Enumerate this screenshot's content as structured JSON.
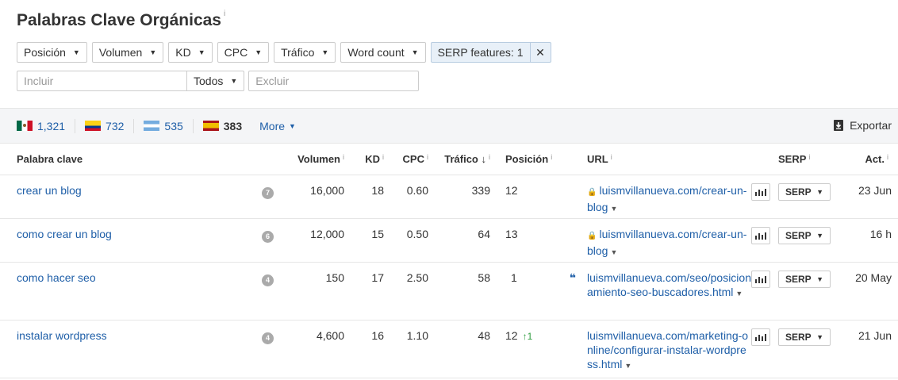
{
  "header": {
    "title": "Palabras Clave Orgánicas",
    "info": "i"
  },
  "filters": [
    {
      "label": "Posición",
      "caret": "▼"
    },
    {
      "label": "Volumen",
      "caret": "▼"
    },
    {
      "label": "KD",
      "caret": "▼"
    },
    {
      "label": "CPC",
      "caret": "▼"
    },
    {
      "label": "Tráfico",
      "caret": "▼"
    },
    {
      "label": "Word count",
      "caret": "▼"
    }
  ],
  "serp_filter": {
    "label": "SERP features: 1",
    "close": "✕"
  },
  "search": {
    "include_placeholder": "Incluir",
    "mode": "Todos",
    "exclude_placeholder": "Excluir"
  },
  "countries": [
    {
      "flag": "mx",
      "count": "1,321"
    },
    {
      "flag": "co",
      "count": "732"
    },
    {
      "flag": "ar",
      "count": "535"
    },
    {
      "flag": "es",
      "count": "383"
    }
  ],
  "more_label": "More",
  "export_label": "Exportar",
  "columns": {
    "keyword": "Palabra clave",
    "volume": "Volumen",
    "kd": "KD",
    "cpc": "CPC",
    "traffic": "Tráfico",
    "position": "Posición",
    "url": "URL",
    "serp": "SERP",
    "updated": "Act."
  },
  "rows": [
    {
      "keyword": "crear un blog",
      "word_count": "7",
      "volume": "16,000",
      "kd": "18",
      "cpc": "0.60",
      "traffic": "339",
      "position": "12",
      "position_change": "",
      "quote": "",
      "secure": true,
      "url": "luismvillanueva.com/crear-un-blog",
      "serp": "SERP",
      "updated": "23 Jun"
    },
    {
      "keyword": "como crear un blog",
      "word_count": "6",
      "volume": "12,000",
      "kd": "15",
      "cpc": "0.50",
      "traffic": "64",
      "position": "13",
      "position_change": "",
      "quote": "",
      "secure": true,
      "url": "luismvillanueva.com/crear-un-blog",
      "serp": "SERP",
      "updated": "16 h"
    },
    {
      "keyword": "como hacer seo",
      "word_count": "4",
      "volume": "150",
      "kd": "17",
      "cpc": "2.50",
      "traffic": "58",
      "position": "1",
      "position_change": "",
      "quote": "❝",
      "secure": false,
      "url": "luismvillanueva.com/seo/posicionamiento-seo-buscadores.html",
      "serp": "SERP",
      "updated": "20 May"
    },
    {
      "keyword": "instalar wordpress",
      "word_count": "4",
      "volume": "4,600",
      "kd": "16",
      "cpc": "1.10",
      "traffic": "48",
      "position": "12",
      "position_change": "↑1",
      "quote": "",
      "secure": false,
      "url": "luismvillanueva.com/marketing-online/configurar-instalar-wordpress.html",
      "serp": "SERP",
      "updated": "21 Jun"
    }
  ],
  "icons": {
    "lock": "lock-icon",
    "chart": "bar-chart-icon",
    "export": "download-icon",
    "quote": "quote-icon"
  },
  "colors": {
    "link": "#1f5fa8",
    "bar_bg": "#f4f5f7",
    "active_filter": "#e8f0f8",
    "up": "#2e9c3e"
  }
}
